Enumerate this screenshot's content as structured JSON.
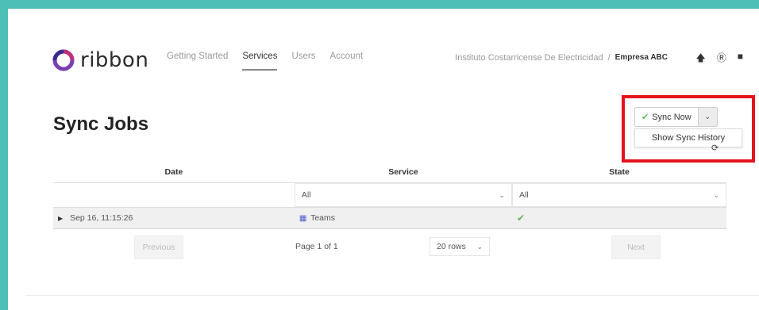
{
  "brand": {
    "logo_text": "ribbon",
    "logo_color": "#5b2d8e"
  },
  "nav": {
    "tabs": [
      {
        "label": "Getting Started",
        "active": false
      },
      {
        "label": "Services",
        "active": true
      },
      {
        "label": "Users",
        "active": false
      },
      {
        "label": "Account",
        "active": false
      }
    ],
    "organization": "Instituto Costarricense De Electricidad",
    "separator": "/",
    "tenant": "Empresa ABC",
    "icons": [
      "upload-icon",
      "help-icon",
      "user-icon"
    ]
  },
  "page": {
    "title": "Sync Jobs"
  },
  "sync": {
    "button_label": "Sync Now",
    "menu_item": "Show Sync History",
    "highlight_color": "#e5131d"
  },
  "table": {
    "columns": [
      "Date",
      "Service",
      "State"
    ],
    "filters": {
      "service": "All",
      "state": "All"
    },
    "rows": [
      {
        "date": "Sep 16, 11:15:26",
        "service": "Teams",
        "state": "success"
      }
    ]
  },
  "pagination": {
    "previous": "Previous",
    "page_info": "Page 1 of 1",
    "rows_option": "20 rows",
    "next": "Next"
  }
}
